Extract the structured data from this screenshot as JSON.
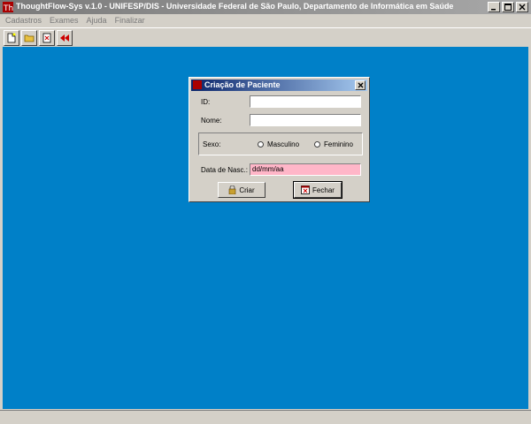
{
  "window": {
    "title": "ThoughtFlow-Sys v.1.0 - UNIFESP/DIS - Universidade Federal de São Paulo, Departamento de Informática em Saúde"
  },
  "menu": [
    "Cadastros",
    "Exames",
    "Ajuda",
    "Finalizar"
  ],
  "toolbar_icons": [
    "new-icon",
    "open-folder-icon",
    "edit-icon",
    "back-icon"
  ],
  "dialog": {
    "title": "Criação de Paciente",
    "id_label": "ID:",
    "id_value": "",
    "nome_label": "Nome:",
    "nome_value": "",
    "sexo_label": "Sexo:",
    "sexo_options": [
      "Masculino",
      "Feminino"
    ],
    "data_label": "Data de Nasc.:",
    "data_value": "dd/mm/aa",
    "criar_label": "Criar",
    "fechar_label": "Fechar"
  },
  "colors": {
    "workspace": "#0080c8",
    "date_field": "#ffb6c8",
    "dialog_title": "#0a246a"
  }
}
